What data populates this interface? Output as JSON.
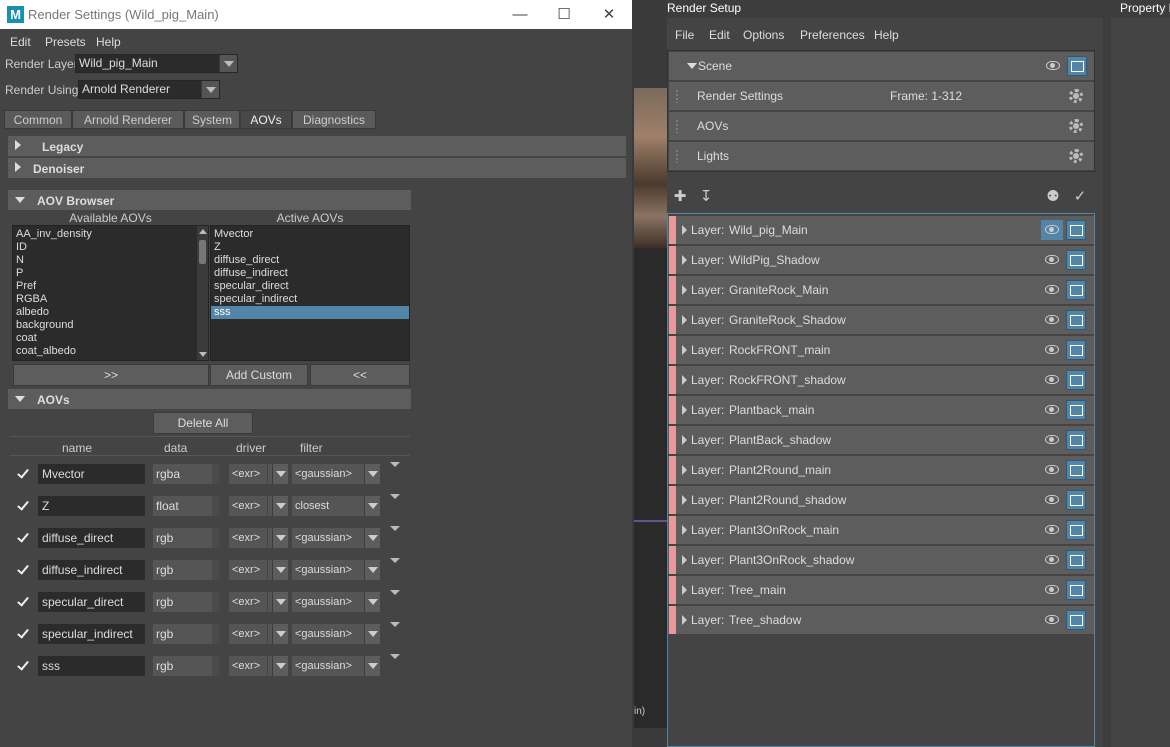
{
  "render_settings": {
    "title": "Render Settings (Wild_pig_Main)",
    "menu": [
      "Edit",
      "Presets",
      "Help"
    ],
    "render_layer_label": "Render Layer",
    "render_layer_value": "Wild_pig_Main",
    "render_using_label": "Render Using",
    "render_using_value": "Arnold Renderer",
    "tabs": [
      "Common",
      "Arnold Renderer",
      "System",
      "AOVs",
      "Diagnostics"
    ],
    "active_tab": "AOVs",
    "sections": {
      "legacy": "Legacy",
      "denoiser": "Denoiser",
      "aov_browser": "AOV Browser",
      "aovs": "AOVs"
    },
    "available_title": "Available AOVs",
    "active_title": "Active AOVs",
    "available_aovs": [
      "AA_inv_density",
      "ID",
      "N",
      "P",
      "Pref",
      "RGBA",
      "albedo",
      "background",
      "coat",
      "coat_albedo"
    ],
    "active_aovs": [
      "Mvector",
      "Z",
      "diffuse_direct",
      "diffuse_indirect",
      "specular_direct",
      "specular_indirect",
      "sss"
    ],
    "selected_active": "sss",
    "buttons": {
      "add": ">>",
      "add_custom": "Add Custom",
      "remove": "<<",
      "delete_all": "Delete All"
    },
    "columns": [
      "name",
      "data",
      "driver",
      "filter"
    ],
    "aov_rows": [
      {
        "name": "Mvector",
        "data": "rgba",
        "driver": "<exr>",
        "filter": "<gaussian>"
      },
      {
        "name": "Z",
        "data": "float",
        "driver": "<exr>",
        "filter": "closest"
      },
      {
        "name": "diffuse_direct",
        "data": "rgb",
        "driver": "<exr>",
        "filter": "<gaussian>"
      },
      {
        "name": "diffuse_indirect",
        "data": "rgb",
        "driver": "<exr>",
        "filter": "<gaussian>"
      },
      {
        "name": "specular_direct",
        "data": "rgb",
        "driver": "<exr>",
        "filter": "<gaussian>"
      },
      {
        "name": "specular_indirect",
        "data": "rgb",
        "driver": "<exr>",
        "filter": "<gaussian>"
      },
      {
        "name": "sss",
        "data": "rgb",
        "driver": "<exr>",
        "filter": "<gaussian>"
      }
    ]
  },
  "viewport": {
    "text": "in)"
  },
  "render_setup": {
    "title": "Render Setup",
    "menu": [
      "File",
      "Edit",
      "Options",
      "Preferences",
      "Help"
    ],
    "scene_label": "Scene",
    "scene_items": [
      {
        "label": "Render Settings",
        "extra": "Frame: 1-312"
      },
      {
        "label": "AOVs",
        "extra": ""
      },
      {
        "label": "Lights",
        "extra": ""
      }
    ],
    "layer_prefix": "Layer:",
    "layers": [
      "Wild_pig_Main",
      "WildPig_Shadow",
      "GraniteRock_Main",
      "GraniteRock_Shadow",
      "RockFRONT_main",
      "RockFRONT_shadow",
      "Plantback_main",
      "PlantBack_shadow",
      "Plant2Round_main",
      "Plant2Round_shadow",
      "Plant3OnRock_main",
      "Plant3OnRock_shadow",
      "Tree_main",
      "Tree_shadow"
    ],
    "highlighted_layer_index": 0
  },
  "property_panel": {
    "title": "Property E"
  },
  "colors": {
    "accent": "#5285a6",
    "layer_strip": "#e89a9a",
    "panel": "#444444"
  }
}
